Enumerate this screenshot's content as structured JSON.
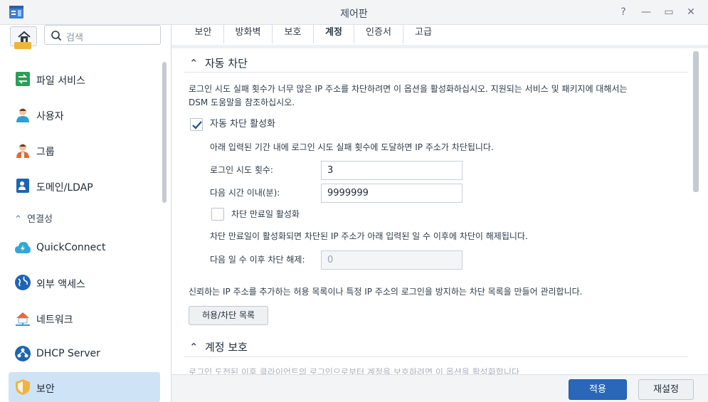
{
  "window": {
    "title": "제어판",
    "help_glyph": "?",
    "minimize_glyph": "—",
    "maximize_glyph": "▭",
    "close_glyph": "✕"
  },
  "sidebar": {
    "search_placeholder": "검색",
    "items_top": [
      {
        "label": "파일 서비스",
        "icon": "file-services-icon"
      },
      {
        "label": "사용자",
        "icon": "user-icon"
      },
      {
        "label": "그룹",
        "icon": "group-icon"
      },
      {
        "label": "도메인/LDAP",
        "icon": "domain-ldap-icon"
      }
    ],
    "section": "연결성",
    "items_bottom": [
      {
        "label": "QuickConnect",
        "icon": "quickconnect-icon"
      },
      {
        "label": "외부 액세스",
        "icon": "external-access-icon"
      },
      {
        "label": "네트워크",
        "icon": "network-icon"
      },
      {
        "label": "DHCP Server",
        "icon": "dhcp-server-icon"
      },
      {
        "label": "보안",
        "icon": "security-shield-icon",
        "selected": true
      }
    ]
  },
  "tabs": [
    "보안",
    "방화벽",
    "보호",
    "계정",
    "인증서",
    "고급"
  ],
  "active_tab": "계정",
  "auto_block": {
    "title": "자동 차단",
    "description_line1": "로그인 시도 실패 횟수가 너무 많은 IP 주소를 차단하려면 이 옵션을 활성화하십시오. 지원되는 서비스 및 패키지에 대해서는",
    "description_line2": "DSM 도움말을 참조하십시오.",
    "enable_label": "자동 차단 활성화",
    "enable_checked": true,
    "enable_hint": "아래 입력된 기간 내에 로그인 시도 실패 횟수에 도달하면 IP 주소가 차단됩니다.",
    "attempts_label": "로그인 시도 횟수:",
    "attempts_value": "3",
    "within_label": "다음 시간 이내(분):",
    "within_value": "9999999",
    "expire_label": "차단 만료일 활성화",
    "expire_checked": false,
    "expire_hint": "차단 만료일이 활성화되면 차단된 IP 주소가 아래 입력된 일 수 이후에 차단이 해제됩니다.",
    "unblock_label": "다음 일 수 이후 차단 해제:",
    "unblock_value": "0",
    "list_description": "신뢰하는 IP 주소를 추가하는 허용 목록이나 특정 IP 주소의 로그인을 방지하는 차단 목록을 만들어 관리합니다.",
    "list_button": "허용/차단 목록"
  },
  "account_protection": {
    "title": "계정 보호",
    "faded_text": "로그인 도전된 이후 클라이언트의 로그인으로부터 계정을 보호하려면 이 옵션을 활성화합니다"
  },
  "footer": {
    "apply": "적용",
    "reset": "재설정"
  },
  "colors": {
    "accent": "#2a67b8",
    "selected_bg": "#cfe3f7"
  }
}
